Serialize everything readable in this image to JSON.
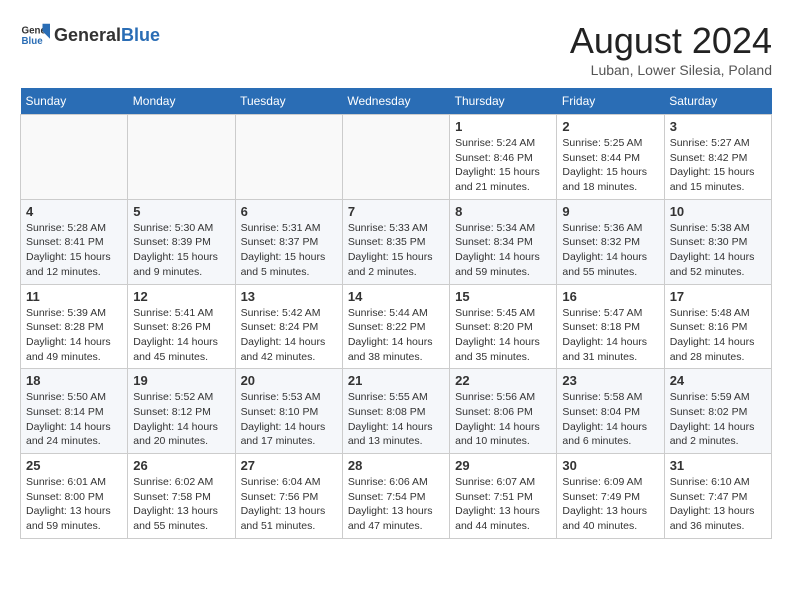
{
  "header": {
    "logo_general": "General",
    "logo_blue": "Blue",
    "title": "August 2024",
    "subtitle": "Luban, Lower Silesia, Poland"
  },
  "weekdays": [
    "Sunday",
    "Monday",
    "Tuesday",
    "Wednesday",
    "Thursday",
    "Friday",
    "Saturday"
  ],
  "weeks": [
    [
      {
        "day": "",
        "info": ""
      },
      {
        "day": "",
        "info": ""
      },
      {
        "day": "",
        "info": ""
      },
      {
        "day": "",
        "info": ""
      },
      {
        "day": "1",
        "info": "Sunrise: 5:24 AM\nSunset: 8:46 PM\nDaylight: 15 hours\nand 21 minutes."
      },
      {
        "day": "2",
        "info": "Sunrise: 5:25 AM\nSunset: 8:44 PM\nDaylight: 15 hours\nand 18 minutes."
      },
      {
        "day": "3",
        "info": "Sunrise: 5:27 AM\nSunset: 8:42 PM\nDaylight: 15 hours\nand 15 minutes."
      }
    ],
    [
      {
        "day": "4",
        "info": "Sunrise: 5:28 AM\nSunset: 8:41 PM\nDaylight: 15 hours\nand 12 minutes."
      },
      {
        "day": "5",
        "info": "Sunrise: 5:30 AM\nSunset: 8:39 PM\nDaylight: 15 hours\nand 9 minutes."
      },
      {
        "day": "6",
        "info": "Sunrise: 5:31 AM\nSunset: 8:37 PM\nDaylight: 15 hours\nand 5 minutes."
      },
      {
        "day": "7",
        "info": "Sunrise: 5:33 AM\nSunset: 8:35 PM\nDaylight: 15 hours\nand 2 minutes."
      },
      {
        "day": "8",
        "info": "Sunrise: 5:34 AM\nSunset: 8:34 PM\nDaylight: 14 hours\nand 59 minutes."
      },
      {
        "day": "9",
        "info": "Sunrise: 5:36 AM\nSunset: 8:32 PM\nDaylight: 14 hours\nand 55 minutes."
      },
      {
        "day": "10",
        "info": "Sunrise: 5:38 AM\nSunset: 8:30 PM\nDaylight: 14 hours\nand 52 minutes."
      }
    ],
    [
      {
        "day": "11",
        "info": "Sunrise: 5:39 AM\nSunset: 8:28 PM\nDaylight: 14 hours\nand 49 minutes."
      },
      {
        "day": "12",
        "info": "Sunrise: 5:41 AM\nSunset: 8:26 PM\nDaylight: 14 hours\nand 45 minutes."
      },
      {
        "day": "13",
        "info": "Sunrise: 5:42 AM\nSunset: 8:24 PM\nDaylight: 14 hours\nand 42 minutes."
      },
      {
        "day": "14",
        "info": "Sunrise: 5:44 AM\nSunset: 8:22 PM\nDaylight: 14 hours\nand 38 minutes."
      },
      {
        "day": "15",
        "info": "Sunrise: 5:45 AM\nSunset: 8:20 PM\nDaylight: 14 hours\nand 35 minutes."
      },
      {
        "day": "16",
        "info": "Sunrise: 5:47 AM\nSunset: 8:18 PM\nDaylight: 14 hours\nand 31 minutes."
      },
      {
        "day": "17",
        "info": "Sunrise: 5:48 AM\nSunset: 8:16 PM\nDaylight: 14 hours\nand 28 minutes."
      }
    ],
    [
      {
        "day": "18",
        "info": "Sunrise: 5:50 AM\nSunset: 8:14 PM\nDaylight: 14 hours\nand 24 minutes."
      },
      {
        "day": "19",
        "info": "Sunrise: 5:52 AM\nSunset: 8:12 PM\nDaylight: 14 hours\nand 20 minutes."
      },
      {
        "day": "20",
        "info": "Sunrise: 5:53 AM\nSunset: 8:10 PM\nDaylight: 14 hours\nand 17 minutes."
      },
      {
        "day": "21",
        "info": "Sunrise: 5:55 AM\nSunset: 8:08 PM\nDaylight: 14 hours\nand 13 minutes."
      },
      {
        "day": "22",
        "info": "Sunrise: 5:56 AM\nSunset: 8:06 PM\nDaylight: 14 hours\nand 10 minutes."
      },
      {
        "day": "23",
        "info": "Sunrise: 5:58 AM\nSunset: 8:04 PM\nDaylight: 14 hours\nand 6 minutes."
      },
      {
        "day": "24",
        "info": "Sunrise: 5:59 AM\nSunset: 8:02 PM\nDaylight: 14 hours\nand 2 minutes."
      }
    ],
    [
      {
        "day": "25",
        "info": "Sunrise: 6:01 AM\nSunset: 8:00 PM\nDaylight: 13 hours\nand 59 minutes."
      },
      {
        "day": "26",
        "info": "Sunrise: 6:02 AM\nSunset: 7:58 PM\nDaylight: 13 hours\nand 55 minutes."
      },
      {
        "day": "27",
        "info": "Sunrise: 6:04 AM\nSunset: 7:56 PM\nDaylight: 13 hours\nand 51 minutes."
      },
      {
        "day": "28",
        "info": "Sunrise: 6:06 AM\nSunset: 7:54 PM\nDaylight: 13 hours\nand 47 minutes."
      },
      {
        "day": "29",
        "info": "Sunrise: 6:07 AM\nSunset: 7:51 PM\nDaylight: 13 hours\nand 44 minutes."
      },
      {
        "day": "30",
        "info": "Sunrise: 6:09 AM\nSunset: 7:49 PM\nDaylight: 13 hours\nand 40 minutes."
      },
      {
        "day": "31",
        "info": "Sunrise: 6:10 AM\nSunset: 7:47 PM\nDaylight: 13 hours\nand 36 minutes."
      }
    ]
  ]
}
